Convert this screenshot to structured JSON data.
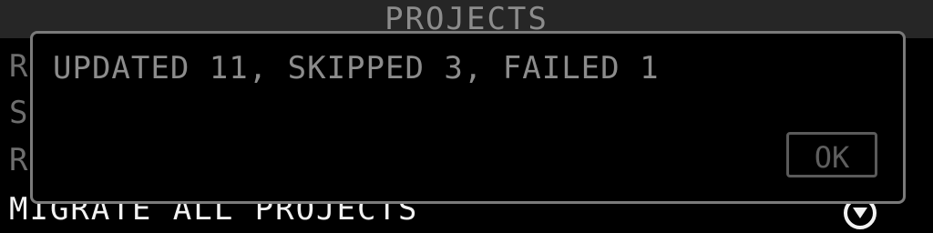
{
  "header": {
    "title": "PROJECTS"
  },
  "menu": {
    "items": [
      {
        "label": "R"
      },
      {
        "label": "S"
      },
      {
        "label": "R"
      },
      {
        "label": "MIGRATE ALL PROJECTS",
        "icon": "cursor-icon",
        "selected": true
      }
    ]
  },
  "dialog": {
    "message": "UPDATED 11, SKIPPED 3, FAILED 1",
    "ok_label": "OK"
  },
  "colors": {
    "background": "#000000",
    "header_bg": "#262626",
    "dialog_border": "#7a7a7a",
    "dim_text": "#8c8c8c",
    "selected_text": "#f2f2f2",
    "button_border": "#5a5a5a"
  }
}
